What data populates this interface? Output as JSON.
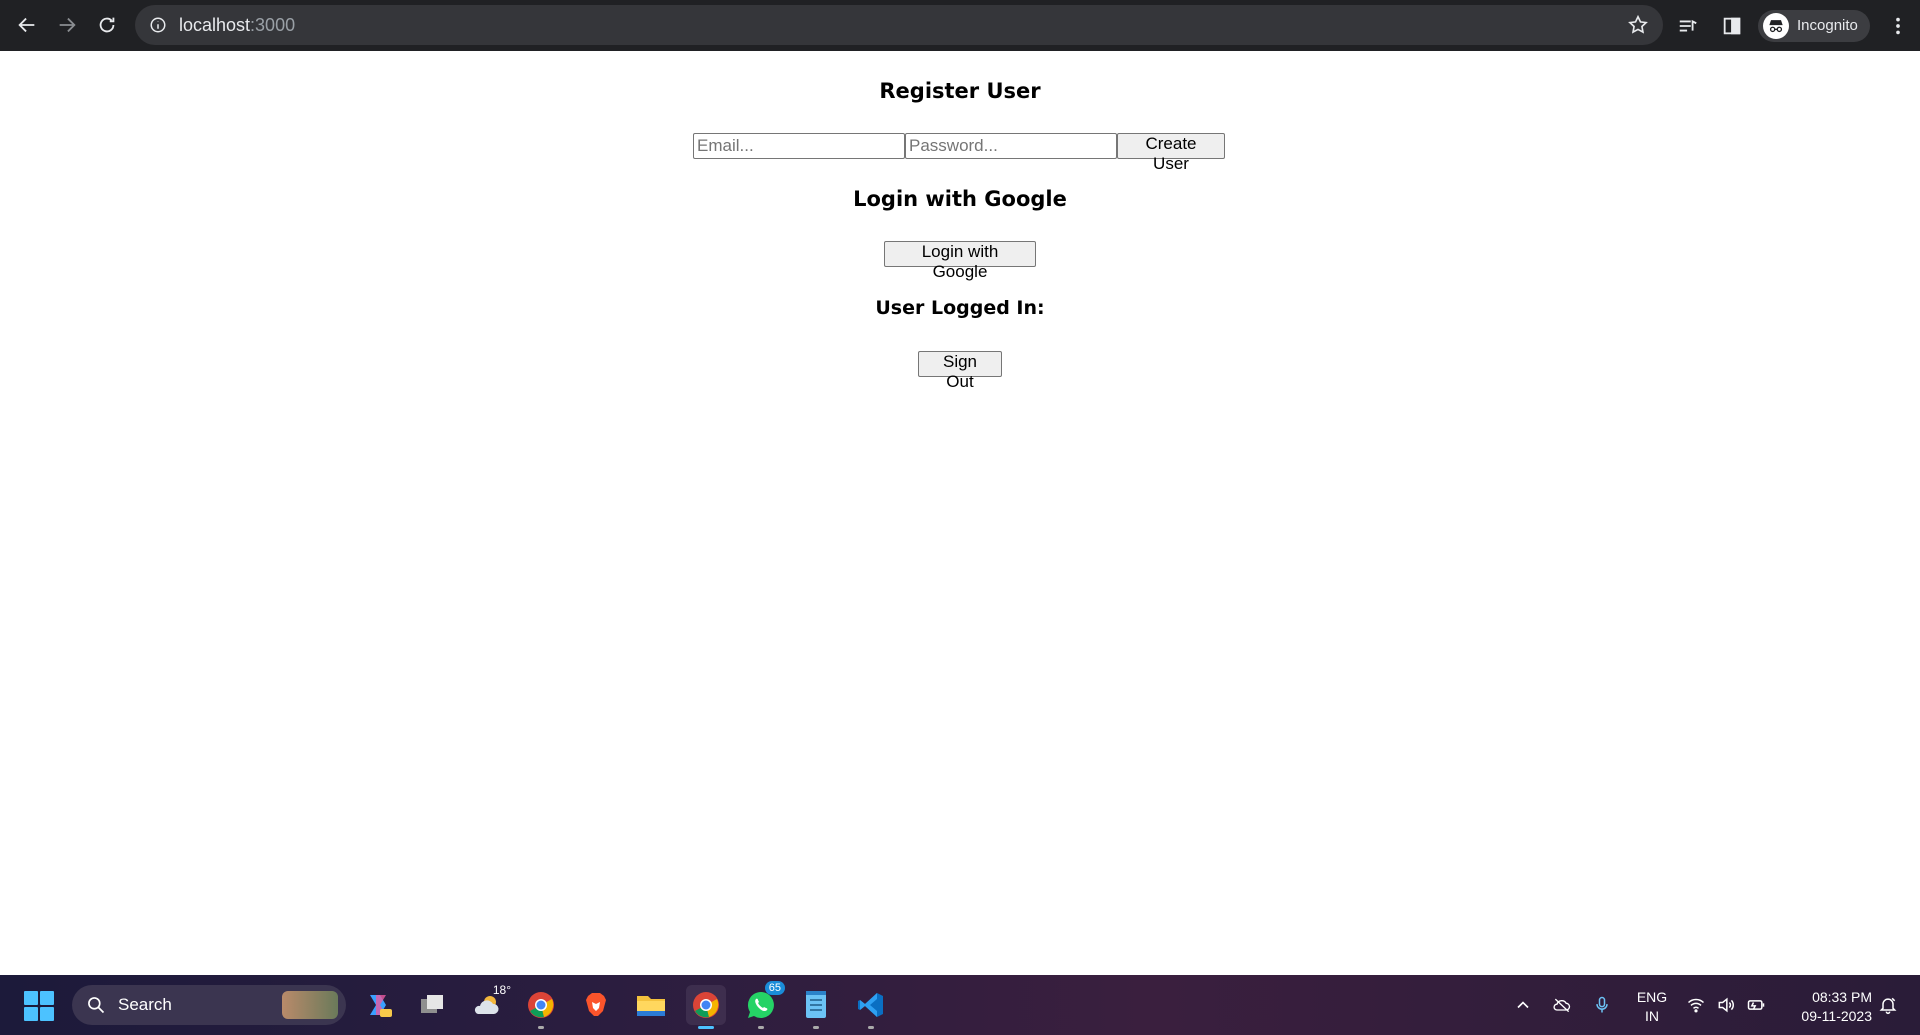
{
  "browser": {
    "url_host": "localhost",
    "url_port": ":3000",
    "profile_label": "Incognito"
  },
  "page": {
    "register_heading": "Register User",
    "email_placeholder": "Email...",
    "password_placeholder": "Password...",
    "create_user_label": "Create User",
    "google_heading": "Login with Google",
    "google_button_label": "Login with Google",
    "logged_in_heading": "User Logged In:",
    "sign_out_label": "Sign Out"
  },
  "taskbar": {
    "search_label": "Search",
    "weather_temp": "18°",
    "whatsapp_badge": "65",
    "lang_line1": "ENG",
    "lang_line2": "IN",
    "time": "08:33 PM",
    "date": "09-11-2023",
    "apps": [
      "copilot-icon",
      "task-view-icon",
      "weather-icon",
      "chrome-icon",
      "brave-icon",
      "file-explorer-icon",
      "chrome-icon",
      "whatsapp-icon",
      "notepad-icon",
      "vscode-icon"
    ]
  }
}
